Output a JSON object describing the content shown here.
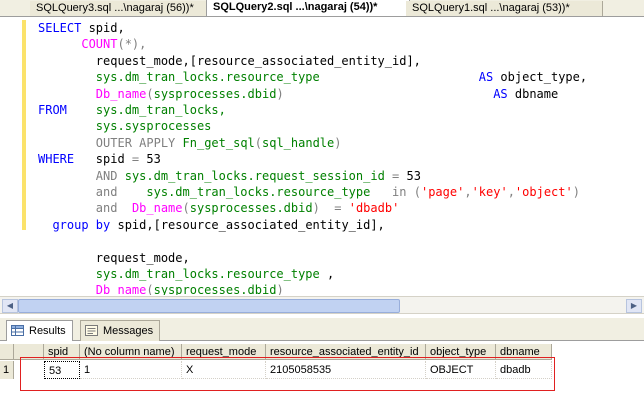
{
  "tabs": [
    {
      "label": "SQLQuery3.sql ...\\nagaraj (56))*",
      "close": "×"
    },
    {
      "label": "SQLQuery2.sql ...\\nagaraj (54))*",
      "close": "×"
    },
    {
      "label": "SQLQuery1.sql ...\\nagaraj (53))*",
      "close": "×"
    }
  ],
  "code_lines": [
    [
      {
        "c": "kw",
        "t": "SELECT"
      },
      {
        "c": "tx",
        "t": " spid,"
      }
    ],
    [
      {
        "c": "tx",
        "t": "      "
      },
      {
        "c": "fn",
        "t": "COUNT"
      },
      {
        "c": "gr",
        "t": "(*),"
      }
    ],
    [
      {
        "c": "tx",
        "t": "        request_mode,[resource_associated_entity_id],"
      }
    ],
    [
      {
        "c": "tx",
        "t": "        "
      },
      {
        "c": "sy",
        "t": "sys.dm_tran_locks.resource_type"
      },
      {
        "c": "tx",
        "t": "                      "
      },
      {
        "c": "kw",
        "t": "AS"
      },
      {
        "c": "tx",
        "t": " object_type,"
      }
    ],
    [
      {
        "c": "tx",
        "t": "        "
      },
      {
        "c": "fn",
        "t": "Db_name"
      },
      {
        "c": "gr",
        "t": "("
      },
      {
        "c": "sy",
        "t": "sysprocesses.dbid"
      },
      {
        "c": "gr",
        "t": ")"
      },
      {
        "c": "tx",
        "t": "                             "
      },
      {
        "c": "kw",
        "t": "AS"
      },
      {
        "c": "tx",
        "t": " dbname"
      }
    ],
    [
      {
        "c": "kw",
        "t": "FROM"
      },
      {
        "c": "tx",
        "t": "    "
      },
      {
        "c": "sy",
        "t": "sys.dm_tran_locks,"
      }
    ],
    [
      {
        "c": "tx",
        "t": "        "
      },
      {
        "c": "sy",
        "t": "sys.sysprocesses"
      }
    ],
    [
      {
        "c": "tx",
        "t": "        "
      },
      {
        "c": "gr",
        "t": "OUTER APPLY"
      },
      {
        "c": "tx",
        "t": " "
      },
      {
        "c": "sy",
        "t": "Fn_get_sql"
      },
      {
        "c": "gr",
        "t": "("
      },
      {
        "c": "sy",
        "t": "sql_handle"
      },
      {
        "c": "gr",
        "t": ")"
      }
    ],
    [
      {
        "c": "kw",
        "t": "WHERE"
      },
      {
        "c": "tx",
        "t": "   spid "
      },
      {
        "c": "gr",
        "t": "="
      },
      {
        "c": "tx",
        "t": " 53"
      }
    ],
    [
      {
        "c": "tx",
        "t": "        "
      },
      {
        "c": "gr",
        "t": "AND"
      },
      {
        "c": "tx",
        "t": " "
      },
      {
        "c": "sy",
        "t": "sys.dm_tran_locks.request_session_id"
      },
      {
        "c": "tx",
        "t": " "
      },
      {
        "c": "gr",
        "t": "="
      },
      {
        "c": "tx",
        "t": " 53"
      }
    ],
    [
      {
        "c": "tx",
        "t": "        "
      },
      {
        "c": "gr",
        "t": "and"
      },
      {
        "c": "tx",
        "t": "    "
      },
      {
        "c": "sy",
        "t": "sys.dm_tran_locks.resource_type"
      },
      {
        "c": "tx",
        "t": "   "
      },
      {
        "c": "gr",
        "t": "in"
      },
      {
        "c": "tx",
        "t": " "
      },
      {
        "c": "gr",
        "t": "("
      },
      {
        "c": "st",
        "t": "'page'"
      },
      {
        "c": "gr",
        "t": ","
      },
      {
        "c": "st",
        "t": "'key'"
      },
      {
        "c": "gr",
        "t": ","
      },
      {
        "c": "st",
        "t": "'object'"
      },
      {
        "c": "gr",
        "t": ")"
      }
    ],
    [
      {
        "c": "tx",
        "t": "        "
      },
      {
        "c": "gr",
        "t": "and"
      },
      {
        "c": "tx",
        "t": "  "
      },
      {
        "c": "fn",
        "t": "Db_name"
      },
      {
        "c": "gr",
        "t": "("
      },
      {
        "c": "sy",
        "t": "sysprocesses.dbid"
      },
      {
        "c": "gr",
        "t": ")"
      },
      {
        "c": "tx",
        "t": "  "
      },
      {
        "c": "gr",
        "t": "="
      },
      {
        "c": "tx",
        "t": " "
      },
      {
        "c": "st",
        "t": "'dbadb'"
      }
    ],
    [
      {
        "c": "tx",
        "t": "  "
      },
      {
        "c": "kw",
        "t": "group by"
      },
      {
        "c": "tx",
        "t": " spid,[resource_associated_entity_id],"
      }
    ],
    [
      {
        "c": "tx",
        "t": ""
      }
    ],
    [
      {
        "c": "tx",
        "t": "        request_mode,"
      }
    ],
    [
      {
        "c": "tx",
        "t": "        "
      },
      {
        "c": "sy",
        "t": "sys.dm_tran_locks.resource_type"
      },
      {
        "c": "tx",
        "t": " ,"
      }
    ],
    [
      {
        "c": "tx",
        "t": "        "
      },
      {
        "c": "fn",
        "t": "Db_name"
      },
      {
        "c": "gr",
        "t": "("
      },
      {
        "c": "sy",
        "t": "sysprocesses.dbid"
      },
      {
        "c": "gr",
        "t": ")"
      }
    ]
  ],
  "results_tabs": {
    "results": "Results",
    "messages": "Messages"
  },
  "grid": {
    "columns": [
      "spid",
      "(No column name)",
      "request_mode",
      "resource_associated_entity_id",
      "object_type",
      "dbname"
    ],
    "rows": [
      {
        "rownum": "1",
        "cells": [
          "53",
          "1",
          "X",
          "2105058535",
          "OBJECT",
          "dbadb"
        ]
      }
    ]
  },
  "colors": {
    "highlight_box": "#e02020",
    "keyword": "#0000ff",
    "function": "#ff00ff",
    "system_object": "#008000",
    "string": "#ff0000"
  },
  "icons": {
    "results": "grid-icon",
    "messages": "messages-icon",
    "scroll_left": "arrow-left-icon",
    "scroll_right": "arrow-right-icon"
  }
}
